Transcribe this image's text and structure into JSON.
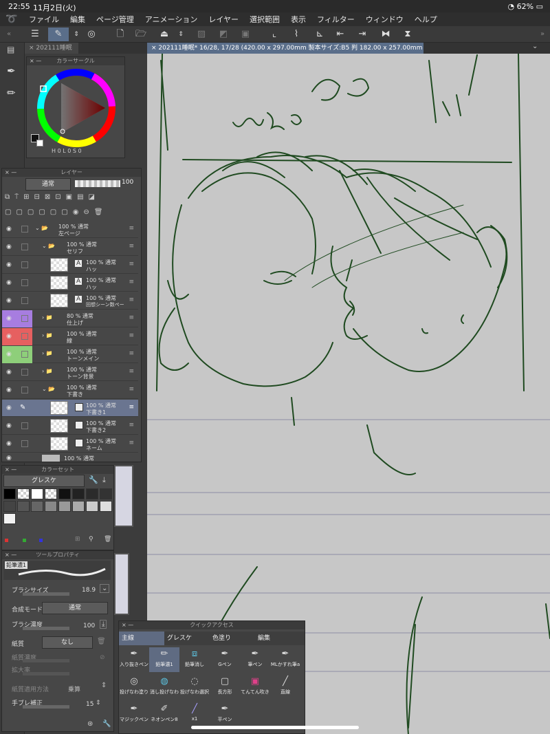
{
  "status": {
    "time": "22:55",
    "date": "11月2日(火)",
    "battery": "62%"
  },
  "menu": [
    "ファイル",
    "編集",
    "ページ管理",
    "アニメーション",
    "レイヤー",
    "選択範囲",
    "表示",
    "フィルター",
    "ウィンドウ",
    "ヘルプ"
  ],
  "tabs": {
    "small_tab": "202111睡眠",
    "doc_tab": "202111睡眠* 16/28, 17/28 (420.00 x 297.00mm 製本サイズ:B5 判 182.00 x 257.00mm 600dpi 69.0%)"
  },
  "color_circle": {
    "title": "カラーサークル",
    "h_label": "H",
    "h_value": "0",
    "s_label": "L",
    "s_value": "0",
    "v_label": "S",
    "v_value": "0"
  },
  "layers_panel": {
    "title": "レイヤー",
    "blend_mode": "通常",
    "opacity": "100",
    "rows": [
      {
        "l1": "100 % 通常",
        "l2": "左ページ"
      },
      {
        "l1": "100 % 通常",
        "l2": "セリフ"
      },
      {
        "l1": "100 % 通常",
        "l2": "ハッ"
      },
      {
        "l1": "100 % 通常",
        "l2": "ハッ"
      },
      {
        "l1": "100 % 通常",
        "l2": "回想シーン数ペー"
      },
      {
        "l1": "80 % 通常",
        "l2": "仕上げ"
      },
      {
        "l1": "100 % 通常",
        "l2": "線"
      },
      {
        "l1": "100 % 通常",
        "l2": "トーンメイン"
      },
      {
        "l1": "100 % 通常",
        "l2": "トーン背景"
      },
      {
        "l1": "100 % 通常",
        "l2": "下書き"
      },
      {
        "l1": "100 % 通常",
        "l2": "下書き1"
      },
      {
        "l1": "100 % 通常",
        "l2": "下書き2"
      },
      {
        "l1": "100 % 通常",
        "l2": "ネーム"
      },
      {
        "l1": "100 % 通常",
        "l2": ""
      }
    ]
  },
  "color_set": {
    "title": "カラーセット",
    "set_name": "グレスケ"
  },
  "tool_property": {
    "title": "ツールプロパティ",
    "brush_name": "鉛筆濃1",
    "brush_size_label": "ブラシサイズ",
    "brush_size": "18.9",
    "blend_label": "合成モード",
    "blend_value": "通常",
    "density_label": "ブラシ濃度",
    "density": "100",
    "paper_label": "紙質",
    "paper_value": "なし",
    "paper_density_label": "紙質濃度",
    "scale_label": "拡大率",
    "paper_apply_label": "紙質適用方法",
    "paper_apply_value": "乗算",
    "stabilizer_label": "手ブレ補正",
    "stabilizer": "15"
  },
  "quick_access": {
    "title": "クイックアクセス",
    "tabs": [
      "主線",
      "グレスケ",
      "色塗り",
      "編集"
    ],
    "tools": [
      {
        "label": "入り抜きペン",
        "icon": "pen-icon"
      },
      {
        "label": "鉛筆濃1",
        "icon": "pencil-icon"
      },
      {
        "label": "鉛筆消し",
        "icon": "eraser-icon"
      },
      {
        "label": "Gペン",
        "icon": "g-pen-icon"
      },
      {
        "label": "筆ペン",
        "icon": "brush-pen-icon"
      },
      {
        "label": "MLかすれ筆a",
        "icon": "brush-icon"
      },
      {
        "label": "投げなわ塗り",
        "icon": "lasso-fill-icon"
      },
      {
        "label": "消し投げなわ",
        "icon": "lasso-erase-icon"
      },
      {
        "label": "投げなわ選択",
        "icon": "lasso-select-icon"
      },
      {
        "label": "長方形",
        "icon": "rectangle-icon"
      },
      {
        "label": "てんてん吹き",
        "icon": "dot-spray-icon"
      },
      {
        "label": "直線",
        "icon": "line-icon"
      },
      {
        "label": "マジックペン",
        "icon": "marker-icon"
      },
      {
        "label": "ネオンペン8",
        "icon": "neon-pen-icon"
      },
      {
        "label": "x1",
        "icon": "stroke-icon"
      },
      {
        "label": "平ペン",
        "icon": "flat-pen-icon"
      }
    ]
  },
  "colors": {
    "canvas": "#c7c7c7",
    "ink": "#1f4a20",
    "accent": "#5a6e8a"
  }
}
